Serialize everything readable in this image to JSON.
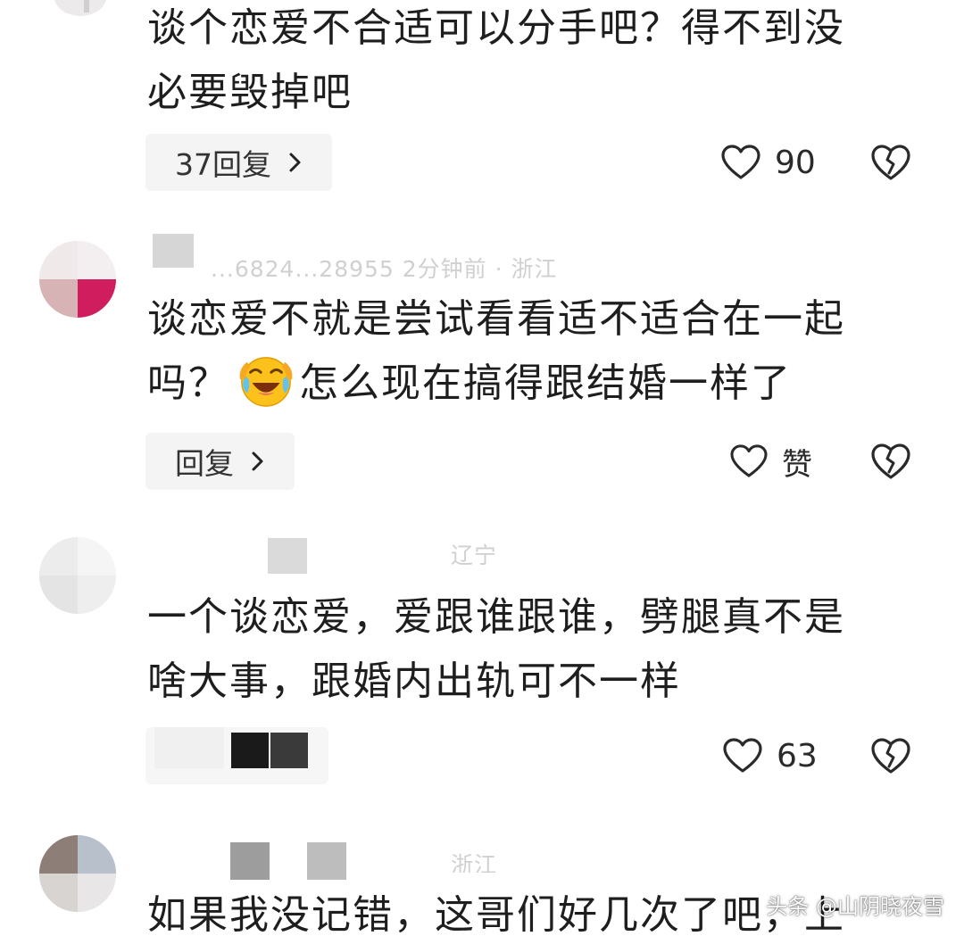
{
  "comments": [
    {
      "text_lines": [
        "谈个恋爱不合适可以分手吧？得不到没",
        "必要毁掉吧"
      ],
      "reply_label": "37回复",
      "likes": "90"
    },
    {
      "meta": "...6824...28955  2分钟前 · 浙江",
      "text_line1_a": "谈恋爱不就是尝试看看适不适合在一起",
      "text_line2_a": "吗？",
      "emoji": "laughing-crying-emoji",
      "text_line2_b": "怎么现在搞得跟结婚一样了",
      "reply_label": "回复",
      "likes": "赞"
    },
    {
      "meta": "辽宁",
      "text_lines": [
        "一个谈恋爱，爱跟谁跟谁，劈腿真不是",
        "啥大事，跟婚内出轨可不一样"
      ],
      "likes": "63"
    },
    {
      "meta": "浙江",
      "text_lines": [
        "如果我没记错，这哥们好几次了吧，上"
      ]
    }
  ],
  "watermark": "头条 @山阴晓夜雪",
  "colors": {
    "text": "#1e1e1e",
    "pill_bg": "#f4f4f4",
    "icon": "#2a2a2a",
    "avatar_accent": "#cf1d5e"
  }
}
